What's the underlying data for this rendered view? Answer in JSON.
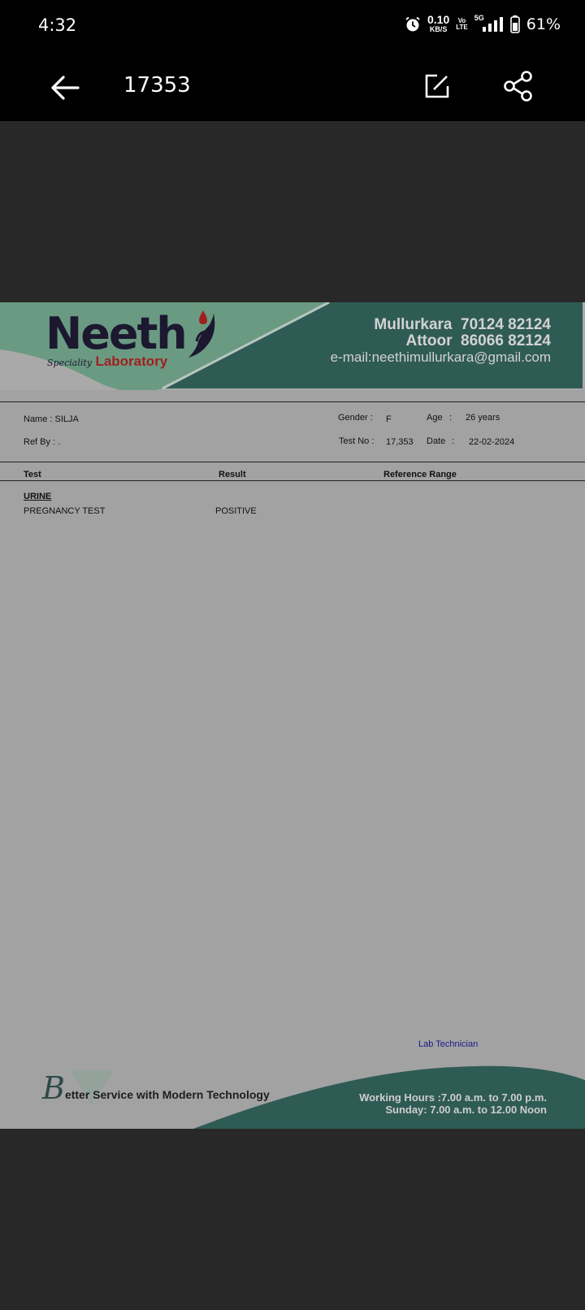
{
  "status_bar": {
    "time": "4:32",
    "net_speed_value": "0.10",
    "net_speed_unit": "KB/S",
    "volte_top": "Vo",
    "volte_bottom": "LTE",
    "network_label": "5G",
    "battery_percent": "61%"
  },
  "app_bar": {
    "title": "17353"
  },
  "report": {
    "lab": {
      "logo_main": "Neeth",
      "logo_speciality": "Speciality",
      "logo_laboratory": "Laboratory",
      "branch_1_name": "Mullurkara",
      "branch_1_phone": "70124 82124",
      "branch_2_name": "Attoor",
      "branch_2_phone": "86066 82124",
      "email": "e-mail:neethimullurkara@gmail.com"
    },
    "patient": {
      "name_label": "Name  :",
      "name": "SILJA",
      "ref_label": "Ref By :",
      "ref_value": ".",
      "gender_label": "Gender :",
      "gender": "F",
      "age_label": "Age",
      "age_sep": ":",
      "age": "26 years",
      "testno_label": "Test No :",
      "testno": "17,353",
      "date_label": "Date",
      "date_sep": ":",
      "date": "22-02-2024"
    },
    "columns": {
      "test": "Test",
      "result": "Result",
      "range": "Reference Range"
    },
    "section": "URINE",
    "rows": [
      {
        "test": "PREGNANCY TEST",
        "result": "POSITIVE"
      }
    ],
    "technician": "Lab Technician",
    "footer": {
      "tagline_initial": "B",
      "tagline_rest": "etter Service with Modern Technology",
      "hours_line1": "Working Hours :7.00 a.m. to 7.00 p.m.",
      "hours_line2": "Sunday: 7.00 a.m. to 12.00 Noon"
    }
  },
  "colors": {
    "header_dark": "#2f5b55",
    "header_light": "#6a9a82",
    "logo_text": "#1c1830",
    "logo_red": "#a02020",
    "backdrop": "#282828"
  }
}
